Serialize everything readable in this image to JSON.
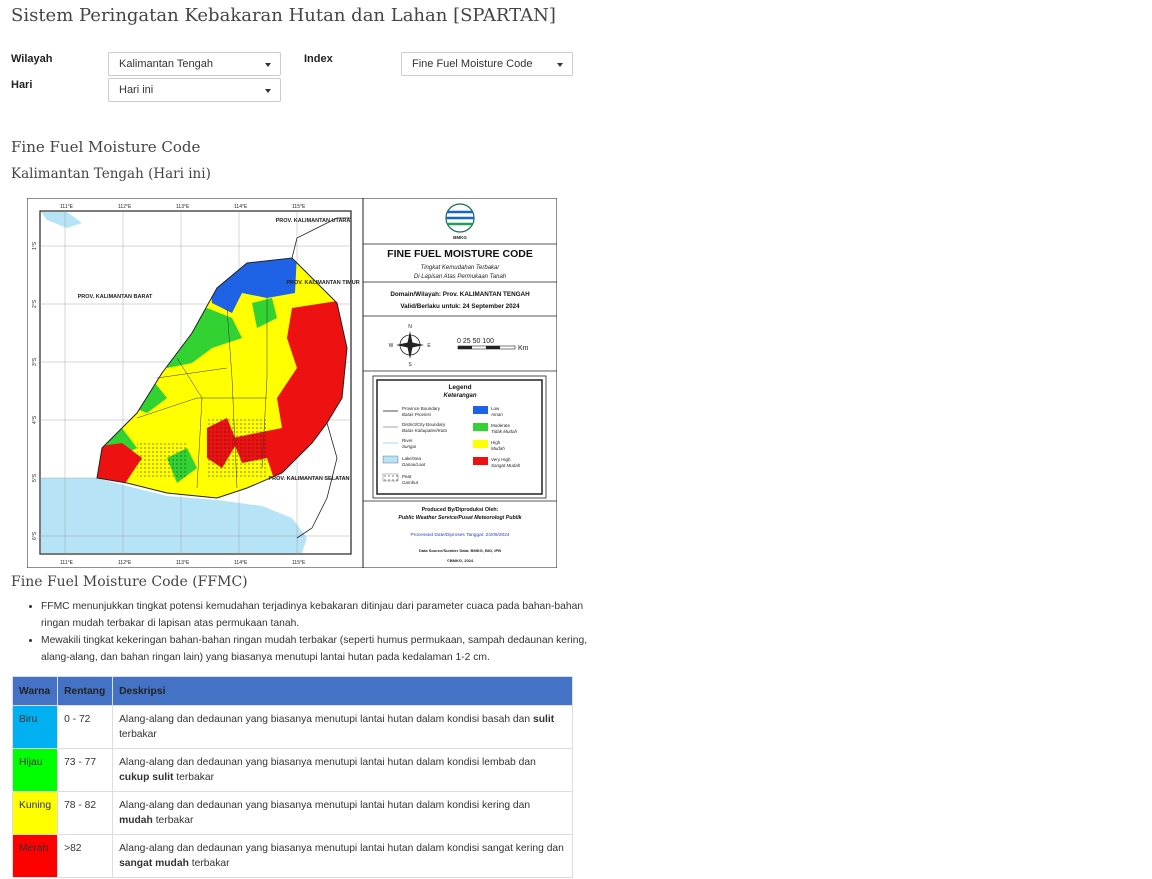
{
  "page": {
    "title": "Sistem Peringatan Kebakaran Hutan dan Lahan [SPARTAN]"
  },
  "filters": {
    "wilayah_label": "Wilayah",
    "wilayah_value": "Kalimantan Tengah",
    "hari_label": "Hari",
    "hari_value": "Hari ini",
    "index_label": "Index",
    "index_value": "Fine Fuel Moisture Code"
  },
  "section": {
    "heading": "Fine Fuel Moisture Code",
    "subheading": "Kalimantan Tengah (Hari ini)"
  },
  "map": {
    "lon_ticks": [
      "111°E",
      "112°E",
      "113°E",
      "114°E",
      "115°E"
    ],
    "lat_ticks": [
      "1°S",
      "2°S",
      "3°S",
      "4°S",
      "5°S",
      "6°S"
    ],
    "province_labels": [
      "PROV. KALIMANTAN UTARA",
      "PROV. KALIMANTAN BARAT",
      "PROV. KALIMANTAN TIMUR",
      "PROV. KALIMANTAN SELATAN"
    ],
    "logo_text": "BMKG",
    "title": "FINE FUEL MOISTURE CODE",
    "subtitle1": "Tingkat Kemudahan Terbakar",
    "subtitle2": "Di Lapisan Atas Permukaan Tanah",
    "domain_line": "Domain/Wilayah: Prov. KALIMANTAN TENGAH",
    "valid_line": "Valid/Berlaku untuk: 24 September 2024",
    "scale_text": "0  25 50     100",
    "scale_unit": "Km",
    "compass": [
      "N",
      "E",
      "S",
      "W"
    ],
    "legend_title": "Legend",
    "legend_subtitle": "Keterangan",
    "legend_lines": [
      {
        "en": "Province Boundary",
        "id": "Batas Provinsi"
      },
      {
        "en": "District/City Boundary",
        "id": "Batas Kabupaten/Kota"
      },
      {
        "en": "River",
        "id": "Sungai"
      },
      {
        "en": "Lake/Sea",
        "id": "Danau/Laut"
      },
      {
        "en": "Peat",
        "id": "Gambut"
      }
    ],
    "legend_classes": [
      {
        "en": "Low",
        "id": "Aman",
        "color": "#1e63e6"
      },
      {
        "en": "Moderate",
        "id": "Tidak Mudah",
        "color": "#32d232"
      },
      {
        "en": "High",
        "id": "Mudah",
        "color": "#ffff00"
      },
      {
        "en": "Very High",
        "id": "Sangat Mudah",
        "color": "#ee1111"
      }
    ],
    "produced_by": "Produced By/Diproduksi Oleh:",
    "produced_org": "Public Weather Service/Pusat Meteorologi Publik",
    "processed": "Processed Date/Diproses Tanggal: 24/09/2024",
    "data_source": "Data Source/Sumber Data: BMKG, BIG, IPB",
    "copyright": "©BMKG, 2024"
  },
  "ffmc": {
    "heading": "Fine Fuel Moisture Code (FFMC)",
    "note1": "FFMC menunjukkan tingkat potensi kemudahan terjadinya kebakaran ditinjau dari parameter cuaca pada bahan-bahan ringan mudah terbakar di lapisan atas permukaan tanah.",
    "note2": "Mewakili tingkat kekeringan bahan-bahan ringan mudah terbakar (seperti humus permukaan, sampah dedaunan kering, alang-alang, dan bahan ringan lain) yang biasanya menutupi lantai hutan pada kedalaman 1-2 cm."
  },
  "table": {
    "headers": [
      "Warna",
      "Rentang",
      "Deskripsi"
    ],
    "rows": [
      {
        "warna": "Biru",
        "color": "#00b0f0",
        "rentang": "0 - 72",
        "desc_pre": "Alang-alang dan dedaunan yang biasanya menutupi lantai hutan dalam kondisi basah dan ",
        "desc_bold": "sulit",
        "desc_post": " terbakar"
      },
      {
        "warna": "Hijau",
        "color": "#00ff00",
        "rentang": "73 - 77",
        "desc_pre": "Alang-alang dan dedaunan yang biasanya menutupi lantai hutan dalam kondisi lembab dan ",
        "desc_bold": "cukup sulit",
        "desc_post": " terbakar"
      },
      {
        "warna": "Kuning",
        "color": "#ffff00",
        "rentang": "78 - 82",
        "desc_pre": "Alang-alang dan dedaunan yang biasanya menutupi lantai hutan dalam kondisi kering dan ",
        "desc_bold": "mudah",
        "desc_post": " terbakar"
      },
      {
        "warna": "Merah",
        "color": "#ff0000",
        "rentang": ">82",
        "desc_pre": "Alang-alang dan dedaunan yang biasanya menutupi lantai hutan dalam kondisi sangat kering dan ",
        "desc_bold": "sangat mudah",
        "desc_post": " terbakar"
      }
    ]
  }
}
